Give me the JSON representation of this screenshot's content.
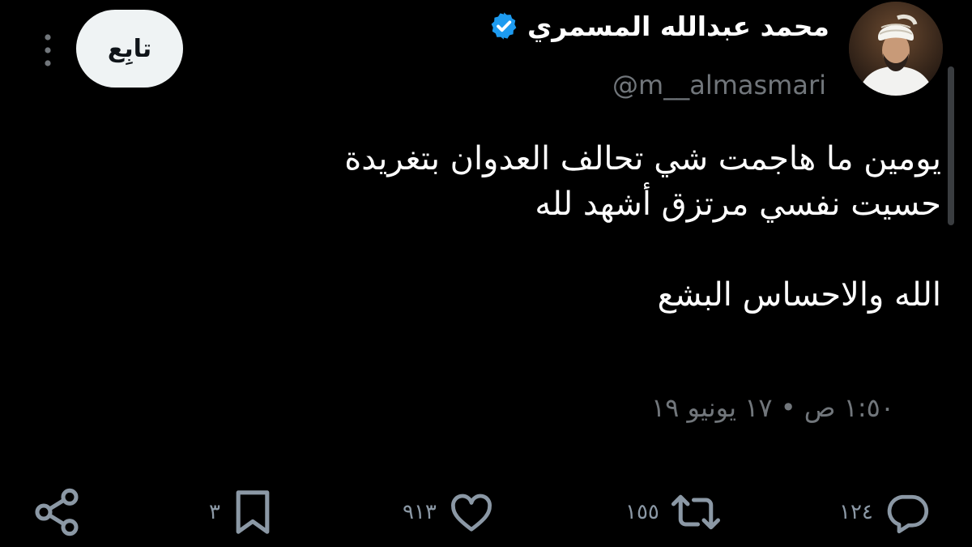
{
  "author": {
    "display_name": "محمد عبدالله المسمري",
    "handle": "@m__almasmari",
    "verified": true,
    "verified_color": "#1d9bf0"
  },
  "header": {
    "follow_label": "تابِع"
  },
  "tweet": {
    "lines": [
      "يومين ما هاجمت شي تحالف العدوان بتغريدة",
      "حسيت نفسي مرتزق أشهد لله",
      "الله والاحساس البشع"
    ],
    "timestamp": "١:٥٠ ص • ١٧ يونيو ١٩"
  },
  "actions": {
    "replies": "١٢٤",
    "retweets": "١٥٥",
    "likes": "٩١٣",
    "bookmarks": "٣"
  },
  "icons": {
    "reply": "reply-icon",
    "retweet": "retweet-icon",
    "like": "heart-icon",
    "bookmark": "bookmark-icon",
    "share": "share-icon",
    "more": "more-vertical-icon",
    "verified": "verified-badge-icon"
  },
  "colors": {
    "background": "#000000",
    "text": "#ffffff",
    "muted": "#71767b",
    "follow_button_bg": "#eff3f4"
  }
}
